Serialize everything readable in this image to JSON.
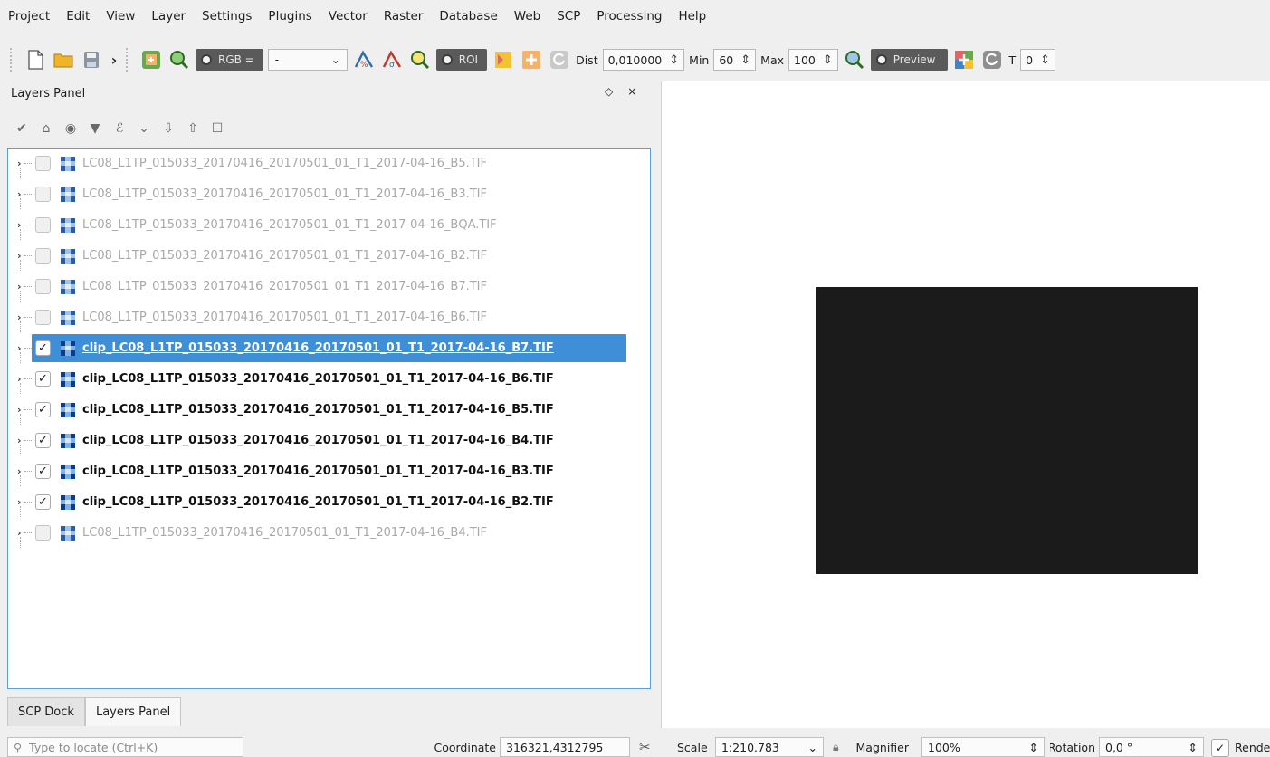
{
  "menu": [
    "Project",
    "Edit",
    "View",
    "Layer",
    "Settings",
    "Plugins",
    "Vector",
    "Raster",
    "Database",
    "Web",
    "SCP",
    "Processing",
    "Help"
  ],
  "toolbar": {
    "rgb_label": "RGB =",
    "rgb_value": "-",
    "roi_label": "ROI",
    "dist_label": "Dist",
    "dist_value": "0,010000",
    "min_label": "Min",
    "min_value": "60",
    "max_label": "Max",
    "max_value": "100",
    "preview_label": "Preview",
    "t_label": "T",
    "t_value": "0"
  },
  "layers_panel": {
    "title": "Layers Panel",
    "float_icon": "◇",
    "close_icon": "×",
    "layers": [
      {
        "name": "LC08_L1TP_015033_20170416_20170501_01_T1_2017-04-16_B5.TIF",
        "checked": false
      },
      {
        "name": "LC08_L1TP_015033_20170416_20170501_01_T1_2017-04-16_B3.TIF",
        "checked": false
      },
      {
        "name": "LC08_L1TP_015033_20170416_20170501_01_T1_2017-04-16_BQA.TIF",
        "checked": false
      },
      {
        "name": "LC08_L1TP_015033_20170416_20170501_01_T1_2017-04-16_B2.TIF",
        "checked": false
      },
      {
        "name": "LC08_L1TP_015033_20170416_20170501_01_T1_2017-04-16_B7.TIF",
        "checked": false
      },
      {
        "name": "LC08_L1TP_015033_20170416_20170501_01_T1_2017-04-16_B6.TIF",
        "checked": false
      },
      {
        "name": "clip_LC08_L1TP_015033_20170416_20170501_01_T1_2017-04-16_B7.TIF",
        "checked": true,
        "selected": true
      },
      {
        "name": "clip_LC08_L1TP_015033_20170416_20170501_01_T1_2017-04-16_B6.TIF",
        "checked": true
      },
      {
        "name": "clip_LC08_L1TP_015033_20170416_20170501_01_T1_2017-04-16_B5.TIF",
        "checked": true
      },
      {
        "name": "clip_LC08_L1TP_015033_20170416_20170501_01_T1_2017-04-16_B4.TIF",
        "checked": true
      },
      {
        "name": "clip_LC08_L1TP_015033_20170416_20170501_01_T1_2017-04-16_B3.TIF",
        "checked": true
      },
      {
        "name": "clip_LC08_L1TP_015033_20170416_20170501_01_T1_2017-04-16_B2.TIF",
        "checked": true
      },
      {
        "name": "LC08_L1TP_015033_20170416_20170501_01_T1_2017-04-16_B4.TIF",
        "checked": false
      }
    ]
  },
  "tabs": [
    "SCP Dock",
    "Layers Panel"
  ],
  "status": {
    "locate_placeholder": "Type to locate (Ctrl+K)",
    "coordinate_label": "Coordinate",
    "coordinate_value": "316321,4312795",
    "scale_label": "Scale",
    "scale_value": "1:210.783",
    "magnifier_label": "Magnifier",
    "magnifier_value": "100%",
    "rotation_label": "Rotation",
    "rotation_value": "0,0 °",
    "render_label": "Render"
  },
  "colors": {
    "selection": "#3e8fd8",
    "raster": "#1b1b1b",
    "tree_border": "#5a9fd6"
  }
}
